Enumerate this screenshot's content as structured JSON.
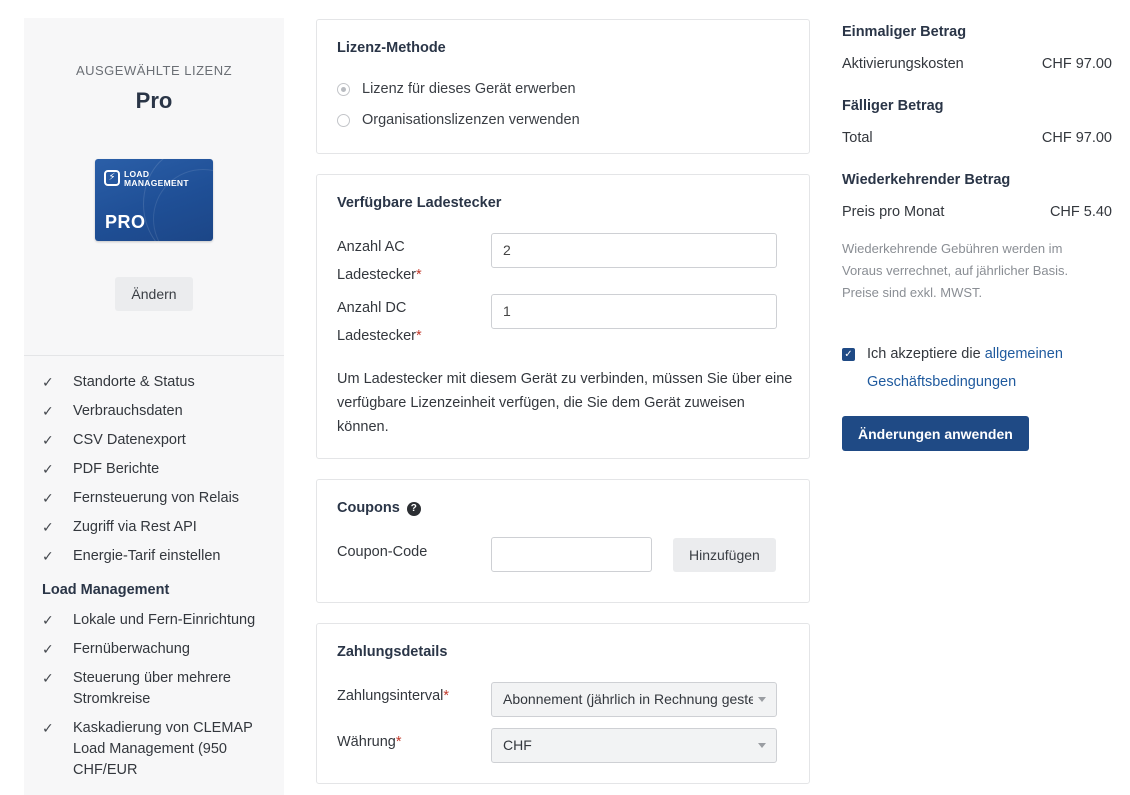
{
  "left": {
    "selected_label": "AUSGEWÄHLTE LIZENZ",
    "plan_name": "Pro",
    "card": {
      "brand_line1": "LOAD",
      "brand_line2": "MANAGEMENT",
      "tier": "PRO",
      "logo_glyph": "⚡"
    },
    "change_button": "Ändern",
    "features": [
      "Standorte & Status",
      "Verbrauchsdaten",
      "CSV Datenexport",
      "PDF Berichte",
      "Fernsteuerung von Relais",
      "Zugriff via Rest API",
      "Energie-Tarif einstellen"
    ],
    "group_title": "Load Management",
    "group_features": [
      "Lokale und Fern-Einrichtung",
      "Fernüberwachung",
      "Steuerung über mehrere Stromkreise",
      "Kaskadierung von CLEMAP Load Management (950 CHF/EUR"
    ],
    "check_glyph": "✓"
  },
  "license_method": {
    "title": "Lizenz-Methode",
    "options": [
      "Lizenz für dieses Gerät erwerben",
      "Organisationslizenzen verwenden"
    ]
  },
  "connectors": {
    "title": "Verfügbare Ladestecker",
    "ac_label": "Anzahl AC Ladestecker",
    "ac_value": "2",
    "dc_label": "Anzahl DC Ladestecker",
    "dc_value": "1",
    "note": "Um Ladestecker mit diesem Gerät zu verbinden, müssen Sie über eine verfügbare Lizenzeinheit verfügen, die Sie dem Gerät zuweisen können."
  },
  "coupons": {
    "title": "Coupons",
    "help_glyph": "?",
    "code_label": "Coupon-Code",
    "code_value": "",
    "add_button": "Hinzufügen"
  },
  "payment": {
    "title": "Zahlungsdetails",
    "interval_label": "Zahlungsinterval",
    "interval_value": "Abonnement (jährlich in Rechnung gestellt)",
    "currency_label": "Währung",
    "currency_value": "CHF"
  },
  "summary": {
    "one_time_title": "Einmaliger Betrag",
    "activation_label": "Aktivierungskosten",
    "activation_value": "CHF 97.00",
    "due_title": "Fälliger Betrag",
    "total_label": "Total",
    "total_value": "CHF 97.00",
    "recurring_title": "Wiederkehrender Betrag",
    "monthly_label": "Preis pro Monat",
    "monthly_value": "CHF 5.40",
    "note": "Wiederkehrende Gebühren werden im Voraus verrechnet, auf jährlicher Basis. Preise sind exkl. MWST.",
    "accept_prefix": "Ich akzeptiere die ",
    "accept_link": "allgemeinen Geschäftsbedingungen",
    "accept_checked": true,
    "apply_button": "Änderungen anwenden"
  },
  "required_mark": "*",
  "colors": {
    "primary": "#1f4a85",
    "link": "#1f5a9e",
    "required": "#c0392b"
  }
}
